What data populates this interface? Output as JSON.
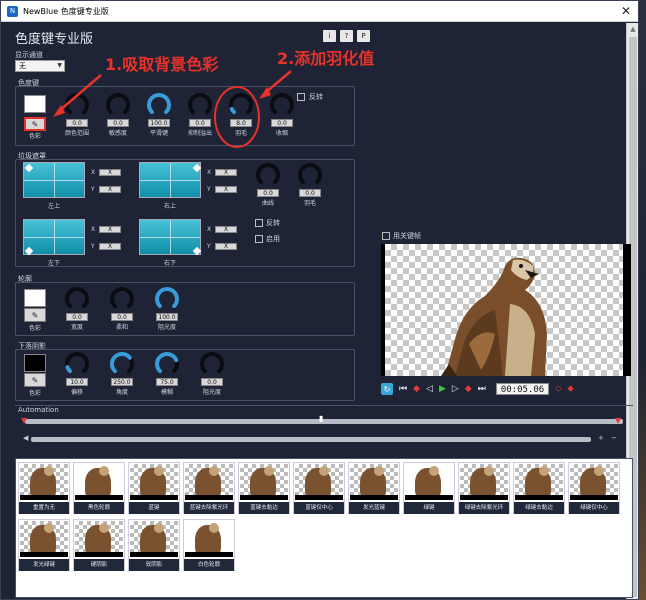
{
  "window": {
    "title": "NewBlue 色度键专业版",
    "app_icon": "newblue-app-icon"
  },
  "header": {
    "title": "色度键专业版",
    "buttons": [
      "i",
      "?",
      "P"
    ]
  },
  "display_channel": {
    "label": "显示通道",
    "value": "无"
  },
  "chroma_key": {
    "section": "色度键",
    "color_label": "色彩",
    "invert_label": "反转",
    "knobs": [
      {
        "value": "0.0",
        "label": "颜色范围",
        "level": 0
      },
      {
        "value": "0.0",
        "label": "敏感度",
        "level": 0
      },
      {
        "value": "100.0",
        "label": "平滑键",
        "level": 1
      },
      {
        "value": "0.0",
        "label": "抑制溢出",
        "level": 0
      },
      {
        "value": "8.0",
        "label": "羽毛",
        "level": 0.08
      },
      {
        "value": "0.0",
        "label": "收缩",
        "level": 0
      }
    ]
  },
  "garbage_matte": {
    "section": "垃圾遮罩",
    "corners": [
      {
        "label": "左上",
        "x": "X",
        "y": "X"
      },
      {
        "label": "右上",
        "x": "X",
        "y": "X"
      },
      {
        "label": "左下",
        "x": "X",
        "y": "X"
      },
      {
        "label": "右下",
        "x": "X",
        "y": "X"
      }
    ],
    "knobs": [
      {
        "value": "0.0",
        "label": "曲线",
        "level": 0
      },
      {
        "value": "0.0",
        "label": "羽毛",
        "level": 0
      }
    ],
    "invert_label": "反转",
    "enable_label": "启用"
  },
  "outline": {
    "section": "轮廓",
    "color_label": "色彩",
    "knobs": [
      {
        "value": "0.0",
        "label": "宽度",
        "level": 0
      },
      {
        "value": "0.0",
        "label": "柔和",
        "level": 0
      },
      {
        "value": "100.0",
        "label": "阻光度",
        "level": 1
      }
    ]
  },
  "drop_shadow": {
    "section": "下落阴影",
    "color_label": "色彩",
    "knobs": [
      {
        "value": "10.0",
        "label": "偏移",
        "level": 0.1
      },
      {
        "value": "250.0",
        "label": "角度",
        "level": 0.69
      },
      {
        "value": "75.0",
        "label": "模糊",
        "level": 0.75
      },
      {
        "value": "0.0",
        "label": "阻光度",
        "level": 0
      }
    ]
  },
  "preview": {
    "keyframe_label": "用关键帧",
    "timecode": "00:05.06"
  },
  "automation": {
    "label": "Automation"
  },
  "presets": [
    "重置为无",
    "黑色轮廓",
    "蓝键",
    "蓝键去除紫光环",
    "蓝键去黏边",
    "蓝键仅中心",
    "发光蓝键",
    "绿键",
    "绿键去除紫光环",
    "绿键去黏边",
    "绿键仅中心",
    "发光绿键",
    "硬阴影",
    "软阴影",
    "白色轮廓"
  ],
  "annotations": {
    "step1": "1.吸取背景色彩",
    "step2": "2.添加羽化值"
  },
  "colors": {
    "panel_bg": "#1e2435",
    "accent_blue": "#3a9bd9",
    "annotation_red": "#e8322a"
  }
}
